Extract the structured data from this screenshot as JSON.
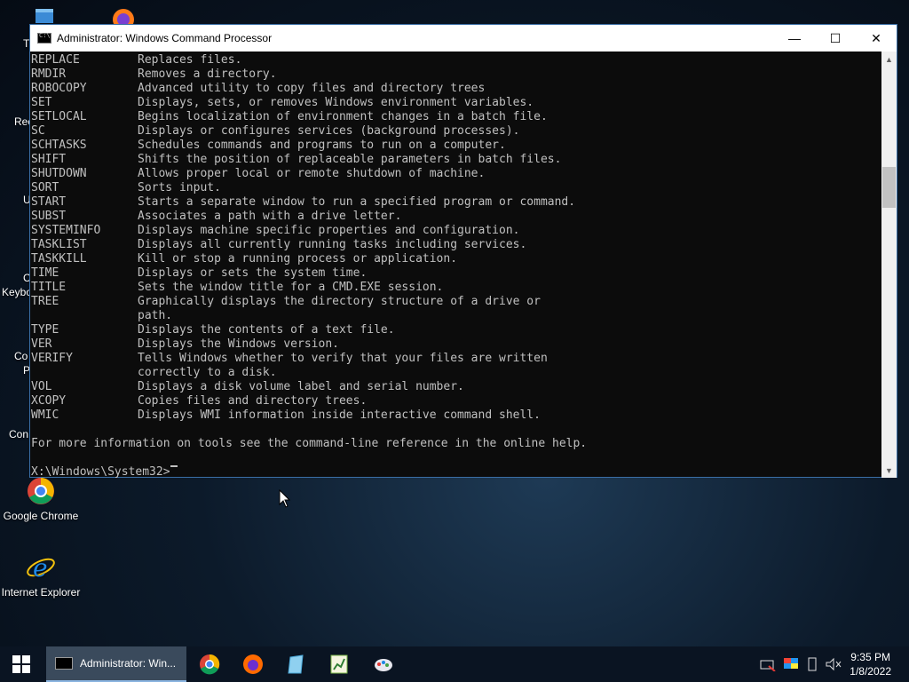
{
  "desktop": {
    "icons": [
      {
        "label": "Google Chrome"
      },
      {
        "label": "Internet Explorer"
      }
    ],
    "partial_labels": [
      "T",
      "Rec",
      "U",
      "C",
      "Keybo",
      "Co",
      "P",
      "Con"
    ]
  },
  "window": {
    "title": "Administrator: Windows Command Processor",
    "buttons": {
      "minimize": "—",
      "maximize": "☐",
      "close": "✕"
    }
  },
  "console": {
    "commands": [
      {
        "name": "REPLACE",
        "desc": "Replaces files."
      },
      {
        "name": "RMDIR",
        "desc": "Removes a directory."
      },
      {
        "name": "ROBOCOPY",
        "desc": "Advanced utility to copy files and directory trees"
      },
      {
        "name": "SET",
        "desc": "Displays, sets, or removes Windows environment variables."
      },
      {
        "name": "SETLOCAL",
        "desc": "Begins localization of environment changes in a batch file."
      },
      {
        "name": "SC",
        "desc": "Displays or configures services (background processes)."
      },
      {
        "name": "SCHTASKS",
        "desc": "Schedules commands and programs to run on a computer."
      },
      {
        "name": "SHIFT",
        "desc": "Shifts the position of replaceable parameters in batch files."
      },
      {
        "name": "SHUTDOWN",
        "desc": "Allows proper local or remote shutdown of machine."
      },
      {
        "name": "SORT",
        "desc": "Sorts input."
      },
      {
        "name": "START",
        "desc": "Starts a separate window to run a specified program or command."
      },
      {
        "name": "SUBST",
        "desc": "Associates a path with a drive letter."
      },
      {
        "name": "SYSTEMINFO",
        "desc": "Displays machine specific properties and configuration."
      },
      {
        "name": "TASKLIST",
        "desc": "Displays all currently running tasks including services."
      },
      {
        "name": "TASKKILL",
        "desc": "Kill or stop a running process or application."
      },
      {
        "name": "TIME",
        "desc": "Displays or sets the system time."
      },
      {
        "name": "TITLE",
        "desc": "Sets the window title for a CMD.EXE session."
      },
      {
        "name": "TREE",
        "desc": "Graphically displays the directory structure of a drive or"
      },
      {
        "name": "",
        "desc": "path."
      },
      {
        "name": "TYPE",
        "desc": "Displays the contents of a text file."
      },
      {
        "name": "VER",
        "desc": "Displays the Windows version."
      },
      {
        "name": "VERIFY",
        "desc": "Tells Windows whether to verify that your files are written"
      },
      {
        "name": "",
        "desc": "correctly to a disk."
      },
      {
        "name": "VOL",
        "desc": "Displays a disk volume label and serial number."
      },
      {
        "name": "XCOPY",
        "desc": "Copies files and directory trees."
      },
      {
        "name": "WMIC",
        "desc": "Displays WMI information inside interactive command shell."
      }
    ],
    "footer": "For more information on tools see the command-line reference in the online help.",
    "prompt": "X:\\Windows\\System32>"
  },
  "taskbar": {
    "active_task_label": "Administrator: Win...",
    "pinned": [
      "chrome-icon",
      "firefox-icon",
      "notepad-icon",
      "spreadsheet-icon",
      "paint-icon"
    ],
    "clock": {
      "time": "9:35 PM",
      "date": "1/8/2022"
    }
  }
}
